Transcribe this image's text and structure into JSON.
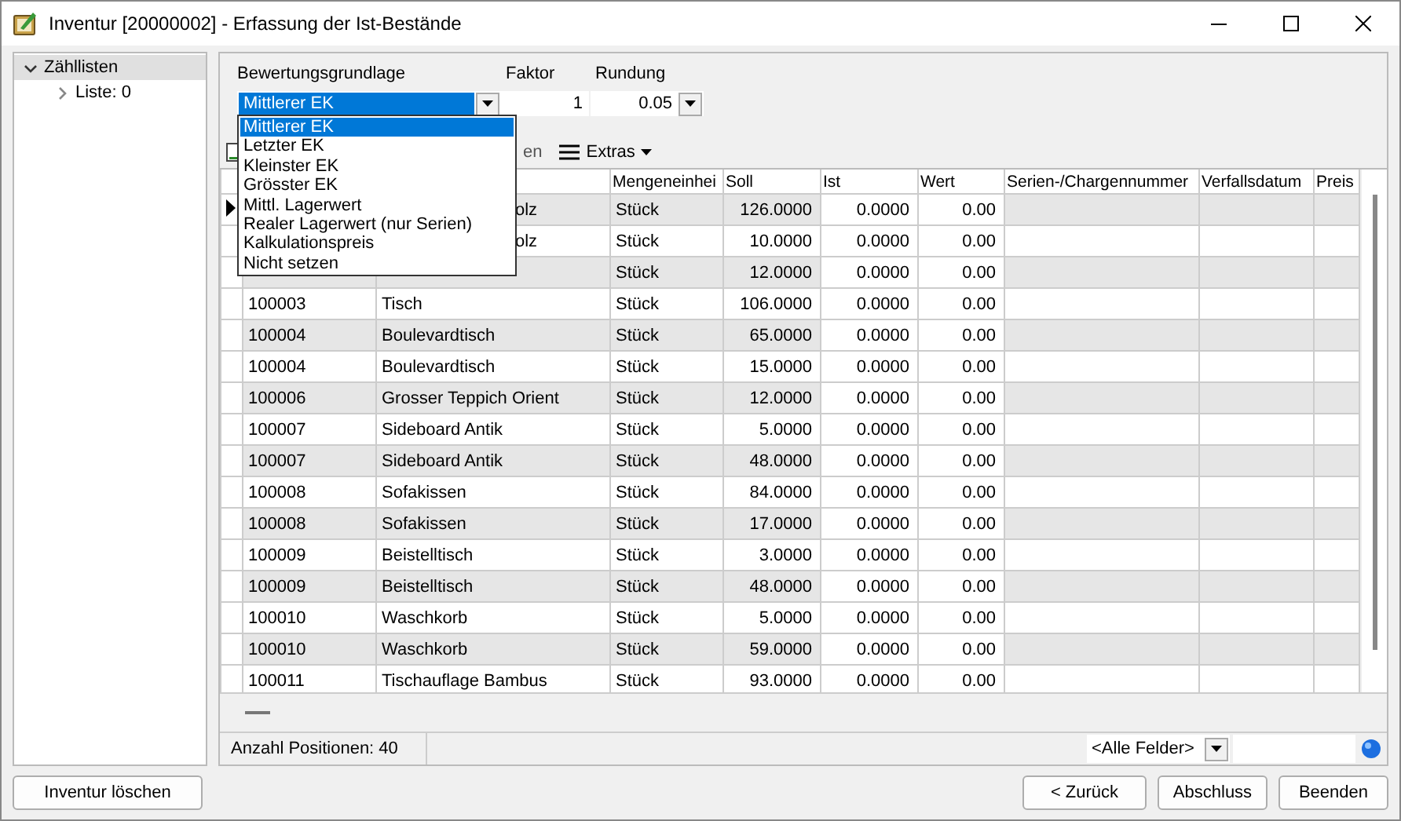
{
  "window": {
    "title": "Inventur [20000002] - Erfassung der Ist-Bestände"
  },
  "tree": [
    {
      "label": "Zähllisten",
      "expanded": true,
      "selected": true,
      "children": [
        {
          "label": "Liste: 0",
          "expanded": false,
          "selected": false
        }
      ]
    }
  ],
  "form": {
    "basis": {
      "label": "Bewertungsgrundlage",
      "value": "Mittlerer EK",
      "options": [
        {
          "label": "Mittlerer EK",
          "selected": true
        },
        {
          "label": "Letzter EK",
          "selected": false
        },
        {
          "label": "Kleinster EK",
          "selected": false
        },
        {
          "label": "Grösster EK",
          "selected": false
        },
        {
          "label": "Mittl. Lagerwert",
          "selected": false
        },
        {
          "label": "Realer Lagerwert (nur Serien)",
          "selected": false
        },
        {
          "label": "Kalkulationspreis",
          "selected": false
        },
        {
          "label": "Nicht setzen",
          "selected": false
        }
      ]
    },
    "factor": {
      "label": "Faktor",
      "value": "1"
    },
    "rounding": {
      "label": "Rundung",
      "value": "0.05"
    }
  },
  "toolbar": [
    {
      "kind": "text",
      "label": "en"
    },
    {
      "kind": "menu",
      "label": "Extras"
    }
  ],
  "table": {
    "columns": [
      "Mengeneinhei",
      "Soll",
      "Ist",
      "Wert",
      "Serien-/Chargennummer",
      "Verfallsdatum",
      "Preis"
    ],
    "rows": [
      {
        "name": "olz",
        "unit": "Stück",
        "soll": "126.0000",
        "ist": "0.0000",
        "wert": "0.00",
        "selected": true
      },
      {
        "name": "olz",
        "unit": "Stück",
        "soll": "10.0000",
        "ist": "0.0000",
        "wert": "0.00",
        "selected": false
      },
      {
        "unit": "Stück",
        "soll": "12.0000",
        "ist": "0.0000",
        "wert": "0.00",
        "selected": false
      },
      {
        "article": "100003",
        "name": "Tisch",
        "unit": "Stück",
        "soll": "106.0000",
        "ist": "0.0000",
        "wert": "0.00",
        "selected": false
      },
      {
        "article": "100004",
        "name": "Boulevardtisch",
        "unit": "Stück",
        "soll": "65.0000",
        "ist": "0.0000",
        "wert": "0.00",
        "selected": false
      },
      {
        "article": "100004",
        "name": "Boulevardtisch",
        "unit": "Stück",
        "soll": "15.0000",
        "ist": "0.0000",
        "wert": "0.00",
        "selected": false
      },
      {
        "article": "100006",
        "name": "Grosser Teppich Orient",
        "unit": "Stück",
        "soll": "12.0000",
        "ist": "0.0000",
        "wert": "0.00",
        "selected": false
      },
      {
        "article": "100007",
        "name": "Sideboard Antik",
        "unit": "Stück",
        "soll": "5.0000",
        "ist": "0.0000",
        "wert": "0.00",
        "selected": false
      },
      {
        "article": "100007",
        "name": "Sideboard Antik",
        "unit": "Stück",
        "soll": "48.0000",
        "ist": "0.0000",
        "wert": "0.00",
        "selected": false
      },
      {
        "article": "100008",
        "name": "Sofakissen",
        "unit": "Stück",
        "soll": "84.0000",
        "ist": "0.0000",
        "wert": "0.00",
        "selected": false
      },
      {
        "article": "100008",
        "name": "Sofakissen",
        "unit": "Stück",
        "soll": "17.0000",
        "ist": "0.0000",
        "wert": "0.00",
        "selected": false
      },
      {
        "article": "100009",
        "name": "Beistelltisch",
        "unit": "Stück",
        "soll": "3.0000",
        "ist": "0.0000",
        "wert": "0.00",
        "selected": false
      },
      {
        "article": "100009",
        "name": "Beistelltisch",
        "unit": "Stück",
        "soll": "48.0000",
        "ist": "0.0000",
        "wert": "0.00",
        "selected": false
      },
      {
        "article": "100010",
        "name": "Waschkorb",
        "unit": "Stück",
        "soll": "5.0000",
        "ist": "0.0000",
        "wert": "0.00",
        "selected": false
      },
      {
        "article": "100010",
        "name": "Waschkorb",
        "unit": "Stück",
        "soll": "59.0000",
        "ist": "0.0000",
        "wert": "0.00",
        "selected": false
      },
      {
        "article": "100011",
        "name": "Tischauflage Bambus",
        "unit": "Stück",
        "soll": "93.0000",
        "ist": "0.0000",
        "wert": "0.00",
        "selected": false
      }
    ]
  },
  "status_bar": {
    "count": "Anzahl Positionen: 40",
    "filter": "<Alle Felder>"
  },
  "buttons": {
    "left": [
      "Inventur löschen"
    ],
    "right": [
      "<  Zurück",
      "Abschluss",
      "Beenden"
    ]
  }
}
